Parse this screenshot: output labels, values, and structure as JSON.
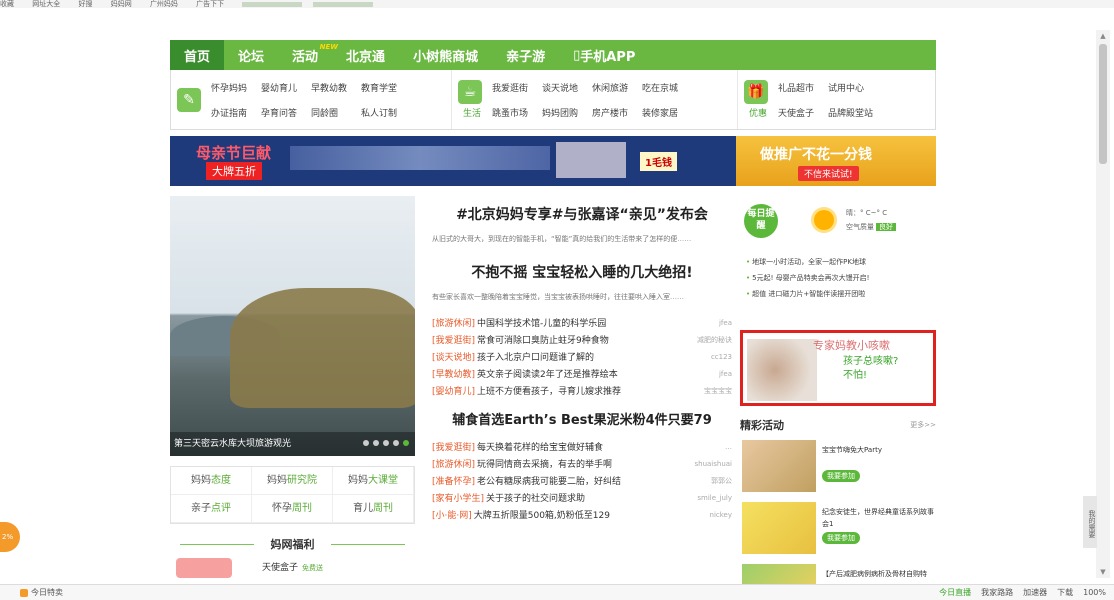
{
  "bookmarks": [
    "收藏",
    "网址大全",
    "好搜",
    "妈妈网",
    "广州妈妈",
    "广告下下"
  ],
  "nav": [
    {
      "label": "首页",
      "active": true
    },
    {
      "label": "论坛"
    },
    {
      "label": "活动",
      "badge": "NEW"
    },
    {
      "label": "北京通"
    },
    {
      "label": "小树熊商城"
    },
    {
      "label": "亲子游"
    },
    {
      "label": "手机APP"
    }
  ],
  "subnav": {
    "group1": {
      "links": [
        "怀孕妈妈",
        "办证指南",
        "婴幼育儿",
        "孕育问答",
        "早教幼教",
        "同龄圈",
        "教育学堂",
        "私人订制"
      ]
    },
    "group2": {
      "head": "生活",
      "links": [
        "我爱逛街",
        "跳蚤市场",
        "谈天说地",
        "妈妈团购",
        "休闲旅游",
        "房产楼市",
        "吃在京城",
        "装修家居"
      ]
    },
    "group3": {
      "head": "优惠",
      "links": [
        "礼品超市",
        "天使盒子",
        "试用中心",
        "品牌殿堂站"
      ]
    }
  },
  "banner": {
    "left_title": "母亲节巨献",
    "left_sub": "大牌五折",
    "left_tag": "1毛钱",
    "right_slogan": "做推广不花一分钱",
    "right_button": "不信来试试!"
  },
  "hero": {
    "caption": "第三天密云水库大坝旅游观光"
  },
  "mama_links": [
    {
      "pre": "妈妈",
      "hl": "态度"
    },
    {
      "pre": "妈妈",
      "hl": "研究院"
    },
    {
      "pre": "妈妈",
      "hl": "大课堂"
    },
    {
      "pre": "亲子",
      "hl": "点评"
    },
    {
      "pre": "怀孕",
      "hl": "周刊"
    },
    {
      "pre": "育儿",
      "hl": "周刊"
    }
  ],
  "mawang": {
    "title": "妈网福利",
    "item": "天使盒子",
    "item_tag": "免费送"
  },
  "middle": {
    "headline1": "#北京妈妈专享#与张嘉译“亲见”发布会",
    "summary1": "从旧式的大哥大，到现在的智能手机，“智能”真的给我们的生活带来了怎样的便",
    "headline2": "不抱不摇 宝宝轻松入睡的几大绝招!",
    "summary2": "有些家长喜欢一整晚陪着宝宝睡觉，当宝宝被表扬哄睡时，往往要哄入睡入室",
    "more": "……",
    "list1": [
      {
        "cat": "[旅游休闲]",
        "title": "中国科学技术馆-儿童的科学乐园",
        "user": "jfea"
      },
      {
        "cat": "[我爱逛街]",
        "title": "常食可消除口臭防止蛀牙9种食物",
        "user": "减肥的秘诀"
      },
      {
        "cat": "[谈天说地]",
        "title": "孩子入北京户口问题谁了解的",
        "user": "cc123"
      },
      {
        "cat": "[早教幼教]",
        "title": "英文亲子阅读读2年了还是推荐绘本",
        "user": "jfea"
      },
      {
        "cat": "[婴幼育儿]",
        "title": "上班不方便看孩子，寻育儿嫂求推荐",
        "user": "宝宝宝宝"
      }
    ],
    "headline3": "辅食首选Earth’s Best果泥米粉4件只要79",
    "list2": [
      {
        "cat": "[我爱逛街]",
        "title": "每天换着花样的给宝宝做好辅食",
        "user": "…"
      },
      {
        "cat": "[旅游休闲]",
        "title": "玩得同情商去采摘，有去的举手啊",
        "user": "shuaishuai"
      },
      {
        "cat": "[准备怀孕]",
        "title": "老公有糖尿病我可能要二胎，好纠结",
        "user": "郭郭公"
      },
      {
        "cat": "[家有小学生]",
        "title": "关于孩子的社交问题求助",
        "user": "smile_july"
      },
      {
        "cat": "[小·能·网]",
        "title": "大牌五折限量500箱,奶粉低至129",
        "user": "nickey"
      }
    ]
  },
  "right": {
    "daily_badge": "每日提醒",
    "weather_line1": "晴：° C~° C",
    "weather_line2": "空气质量",
    "air_quality": "良好",
    "daily_items": [
      "地球一小时活动，全家一起作PK地球",
      "5元起! 母婴产品特卖会再次大馒开启!",
      "超值 进口磁力片+智能伴读摆开团啦"
    ],
    "promo_title": "专家妈教小咳嗽",
    "promo_line1": "孩子总咳嗽?",
    "promo_line2": "不怕!",
    "activities_title": "精彩活动",
    "activities_more": "更多>>",
    "activities": [
      {
        "name": "宝宝节嗨免大Party",
        "join": "我要参加"
      },
      {
        "name": "纪念安徒生，世界经典童话系列故事会1",
        "join": "我要参加"
      },
      {
        "name": "【产后减肥病例病析及骨材自购特"
      }
    ]
  },
  "float_left": "2%",
  "float_right": "我的需要",
  "status": {
    "left": "今日特卖",
    "live": "今日直播",
    "items": [
      "我家路路",
      "加速器",
      "下载",
      "100%"
    ]
  }
}
